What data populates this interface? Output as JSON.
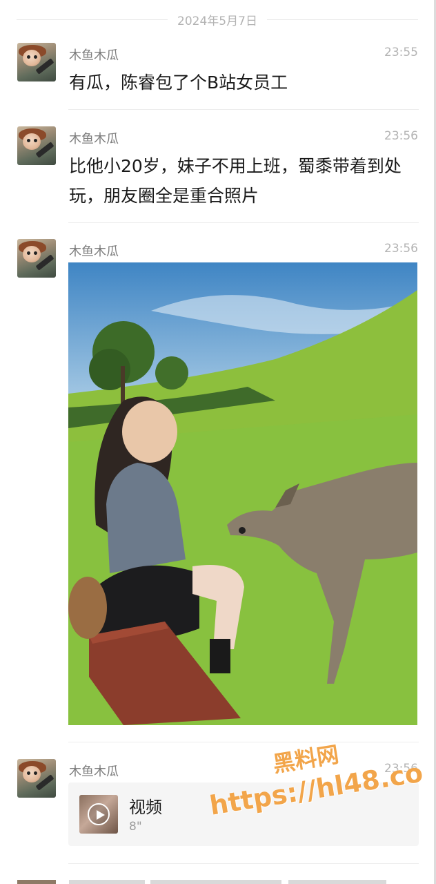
{
  "date_separator": "2024年5月7日",
  "messages": [
    {
      "sender": "木鱼木瓜",
      "time": "23:55",
      "text": "有瓜，陈睿包了个B站女员工"
    },
    {
      "sender": "木鱼木瓜",
      "time": "23:56",
      "text": "比他小20岁，妹子不用上班，蜀黍带着到处玩，朋友圈全是重合照片"
    },
    {
      "sender": "木鱼木瓜",
      "time": "23:56"
    },
    {
      "sender": "木鱼木瓜",
      "time": "23:56",
      "video": {
        "title": "视频",
        "duration": "8\""
      }
    }
  ],
  "watermark": {
    "line1": "黑料网",
    "line2": "https://hl48.co"
  },
  "icons": {
    "avatar": "avatar-image",
    "play": "play-icon"
  }
}
